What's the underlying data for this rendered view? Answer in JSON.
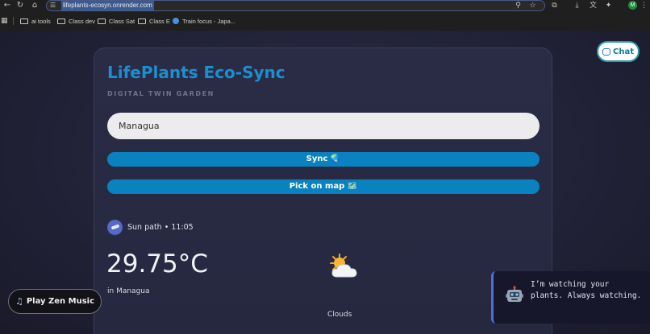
{
  "browser": {
    "url": "lifeplants-ecosyn.onrender.com",
    "bookmarks": [
      {
        "label": "ai tools",
        "type": "folder"
      },
      {
        "label": "Class dev",
        "type": "folder"
      },
      {
        "label": "Class Sat",
        "type": "folder"
      },
      {
        "label": "Class E",
        "type": "folder"
      },
      {
        "label": "Train focus - Japa...",
        "type": "site"
      }
    ],
    "profile_initial": "M"
  },
  "app": {
    "title": "LifePlants Eco-Sync",
    "subtitle": "DIGITAL TWIN GARDEN",
    "city_input_value": "Managua",
    "sync_label": "Sync 🌏",
    "map_label": "Pick on map 🗺️",
    "sun_path_text": "Sun path • 11:05",
    "temperature": "29.75°C",
    "location_text": "in Managua",
    "condition": "Clouds",
    "weather_icon": "sun-behind-cloud-icon"
  },
  "chat": {
    "label": "Chat",
    "icon": "speech-bubble-icon"
  },
  "music": {
    "label": "Play Zen Music",
    "icon": "music-note-icon"
  },
  "toast": {
    "text": "I’m watching your plants. Always watching.",
    "icon": "robot-icon"
  },
  "colors": {
    "accent": "#0a82c0",
    "title": "#1b8fd0",
    "chat_border": "#2e9aa8",
    "toast_border": "#4e6ed8"
  }
}
